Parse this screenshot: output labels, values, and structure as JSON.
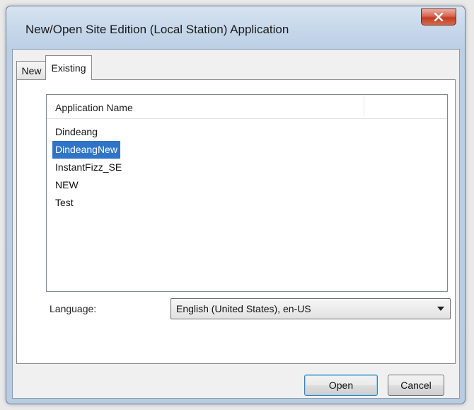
{
  "window": {
    "title": "New/Open Site Edition (Local Station) Application",
    "close_icon": "close-icon"
  },
  "tabs": [
    {
      "label": "New",
      "active": false
    },
    {
      "label": "Existing",
      "active": true
    }
  ],
  "list": {
    "column_header": "Application Name",
    "items": [
      {
        "label": "Dindeang",
        "selected": false
      },
      {
        "label": "DindeangNew",
        "selected": true
      },
      {
        "label": "InstantFizz_SE",
        "selected": false
      },
      {
        "label": "NEW",
        "selected": false
      },
      {
        "label": "Test",
        "selected": false
      }
    ]
  },
  "language": {
    "label": "Language:",
    "selected_value": "English (United States), en-US"
  },
  "buttons": {
    "open_label": "Open",
    "cancel_label": "Cancel"
  },
  "colors": {
    "selection": "#3074c8",
    "close_button": "#c23c24",
    "title_bar": "#c6d7ea"
  }
}
